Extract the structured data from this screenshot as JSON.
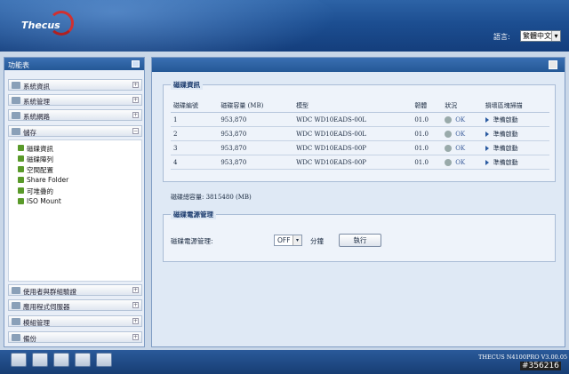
{
  "header": {
    "logo": "Thecus",
    "language_label": "語言:",
    "language_value": "繁體中文"
  },
  "sidebar": {
    "title": "功能表",
    "items": [
      "系統資訊",
      "系統管理",
      "系統網路",
      "儲存",
      "使用者與群組驗證",
      "應用程式伺服器",
      "模組管理",
      "備份"
    ],
    "storage_sub": [
      "磁碟資訊",
      "磁碟陣列",
      "空間配置",
      "Share Folder",
      "可堆疊的",
      "ISO Mount"
    ]
  },
  "disk_panel": {
    "legend": "磁碟資訊",
    "columns": [
      "磁碟編號",
      "磁碟容量 (MB)",
      "模型",
      "韌體",
      "狀況",
      "損壞區塊掃描"
    ],
    "rows": [
      {
        "no": "1",
        "capacity": "953,870",
        "model": "WDC WD10EADS-00L",
        "fw": "01.0",
        "status": "OK",
        "scan": "準備啟動"
      },
      {
        "no": "2",
        "capacity": "953,870",
        "model": "WDC WD10EADS-00L",
        "fw": "01.0",
        "status": "OK",
        "scan": "準備啟動"
      },
      {
        "no": "3",
        "capacity": "953,870",
        "model": "WDC WD10EADS-00P",
        "fw": "01.0",
        "status": "OK",
        "scan": "準備啟動"
      },
      {
        "no": "4",
        "capacity": "953,870",
        "model": "WDC WD10EADS-00P",
        "fw": "01.0",
        "status": "OK",
        "scan": "準備啟動"
      }
    ],
    "total_label": "磁碟總容量:",
    "total_value": "3815480 (MB)"
  },
  "power_panel": {
    "legend": "磁碟電源管理",
    "label": "磁碟電源管理:",
    "value": "OFF",
    "unit": "分鐘",
    "button": "執行"
  },
  "footer": {
    "version": "THECUS N4100PRO V3.00.05"
  },
  "watermark": "#356216"
}
